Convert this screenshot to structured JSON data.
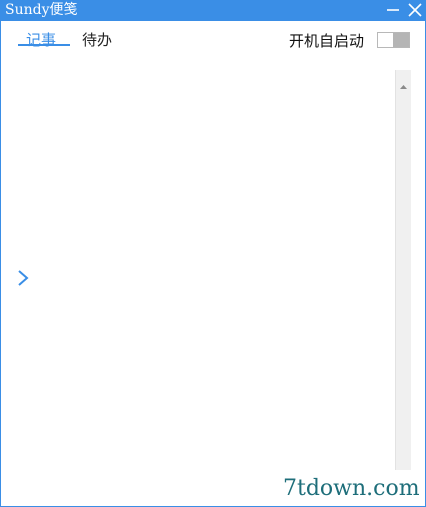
{
  "window": {
    "title": "Sundy便笺",
    "accent_color": "#3a8ee6"
  },
  "titlebar_buttons": {
    "minimize_icon": "minimize-icon",
    "close_icon": "close-icon"
  },
  "tabs": [
    {
      "label": "记事",
      "active": true
    },
    {
      "label": "待办",
      "active": false
    }
  ],
  "autostart": {
    "label": "开机自启动",
    "enabled": false
  },
  "sidebar": {
    "expand_icon": "chevron-right-icon"
  },
  "watermark": {
    "text": "7tdown.com"
  }
}
